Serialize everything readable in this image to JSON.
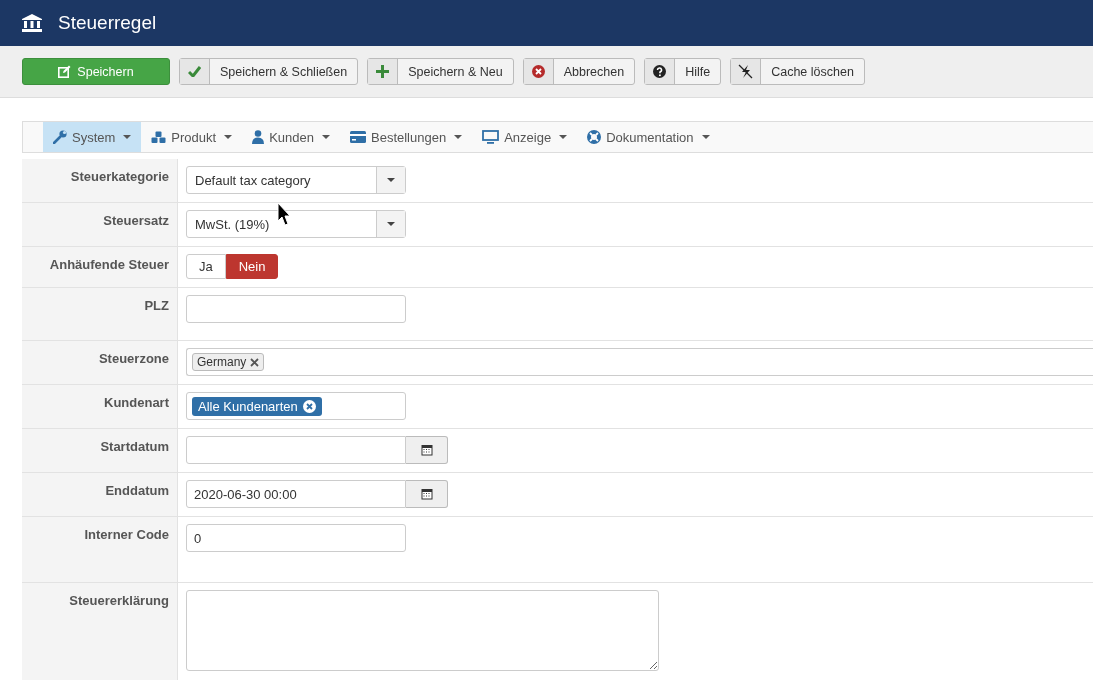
{
  "header": {
    "title": "Steuerregel"
  },
  "toolbar": [
    {
      "label": "Speichern",
      "kind": "primary"
    },
    {
      "label": "Speichern & Schließen",
      "kind": "default"
    },
    {
      "label": "Speichern & Neu",
      "kind": "default"
    },
    {
      "label": "Abbrechen",
      "kind": "default"
    },
    {
      "label": "Hilfe",
      "kind": "default"
    },
    {
      "label": "Cache löschen",
      "kind": "default"
    }
  ],
  "menu": [
    {
      "label": "System",
      "selected": true
    },
    {
      "label": "Produkt",
      "selected": false
    },
    {
      "label": "Kunden",
      "selected": false
    },
    {
      "label": "Bestellungen",
      "selected": false
    },
    {
      "label": "Anzeige",
      "selected": false
    },
    {
      "label": "Dokumentation",
      "selected": false
    }
  ],
  "fields": [
    {
      "label": "Steuerkategorie",
      "kind": "select",
      "value": "Default tax category"
    },
    {
      "label": "Steuersatz",
      "kind": "select",
      "value": "MwSt. (19%)"
    },
    {
      "label": "Anhäufende Steuer",
      "kind": "toggle",
      "options": [
        {
          "label": "Ja",
          "selected": false
        },
        {
          "label": "Nein",
          "selected": true
        }
      ]
    },
    {
      "label": "PLZ",
      "kind": "text"
    },
    {
      "label": "Steuerzone",
      "kind": "tags",
      "tags": [
        "Germany"
      ]
    },
    {
      "label": "Kundenart",
      "kind": "pills",
      "tags": [
        "Alle Kundenarten"
      ]
    },
    {
      "label": "Startdatum",
      "kind": "date"
    },
    {
      "label": "Enddatum",
      "kind": "date",
      "value": "2020-06-30 00:00"
    },
    {
      "label": "Interner Code",
      "kind": "text",
      "value": "0"
    },
    {
      "label": "Steuererklärung",
      "kind": "textarea"
    }
  ]
}
